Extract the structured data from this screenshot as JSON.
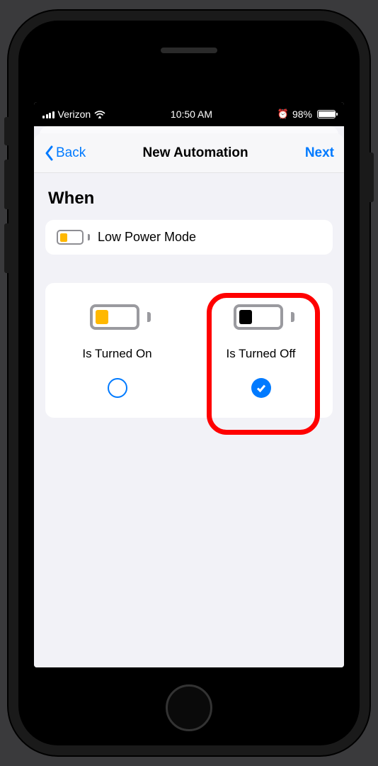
{
  "statusBar": {
    "carrier": "Verizon",
    "time": "10:50 AM",
    "batteryPercent": "98%"
  },
  "nav": {
    "back": "Back",
    "title": "New Automation",
    "next": "Next"
  },
  "section": {
    "heading": "When",
    "trigger": "Low Power Mode"
  },
  "options": {
    "on": {
      "label": "Is Turned On",
      "selected": false,
      "fillColor": "orange"
    },
    "off": {
      "label": "Is Turned Off",
      "selected": true,
      "fillColor": "black"
    }
  }
}
